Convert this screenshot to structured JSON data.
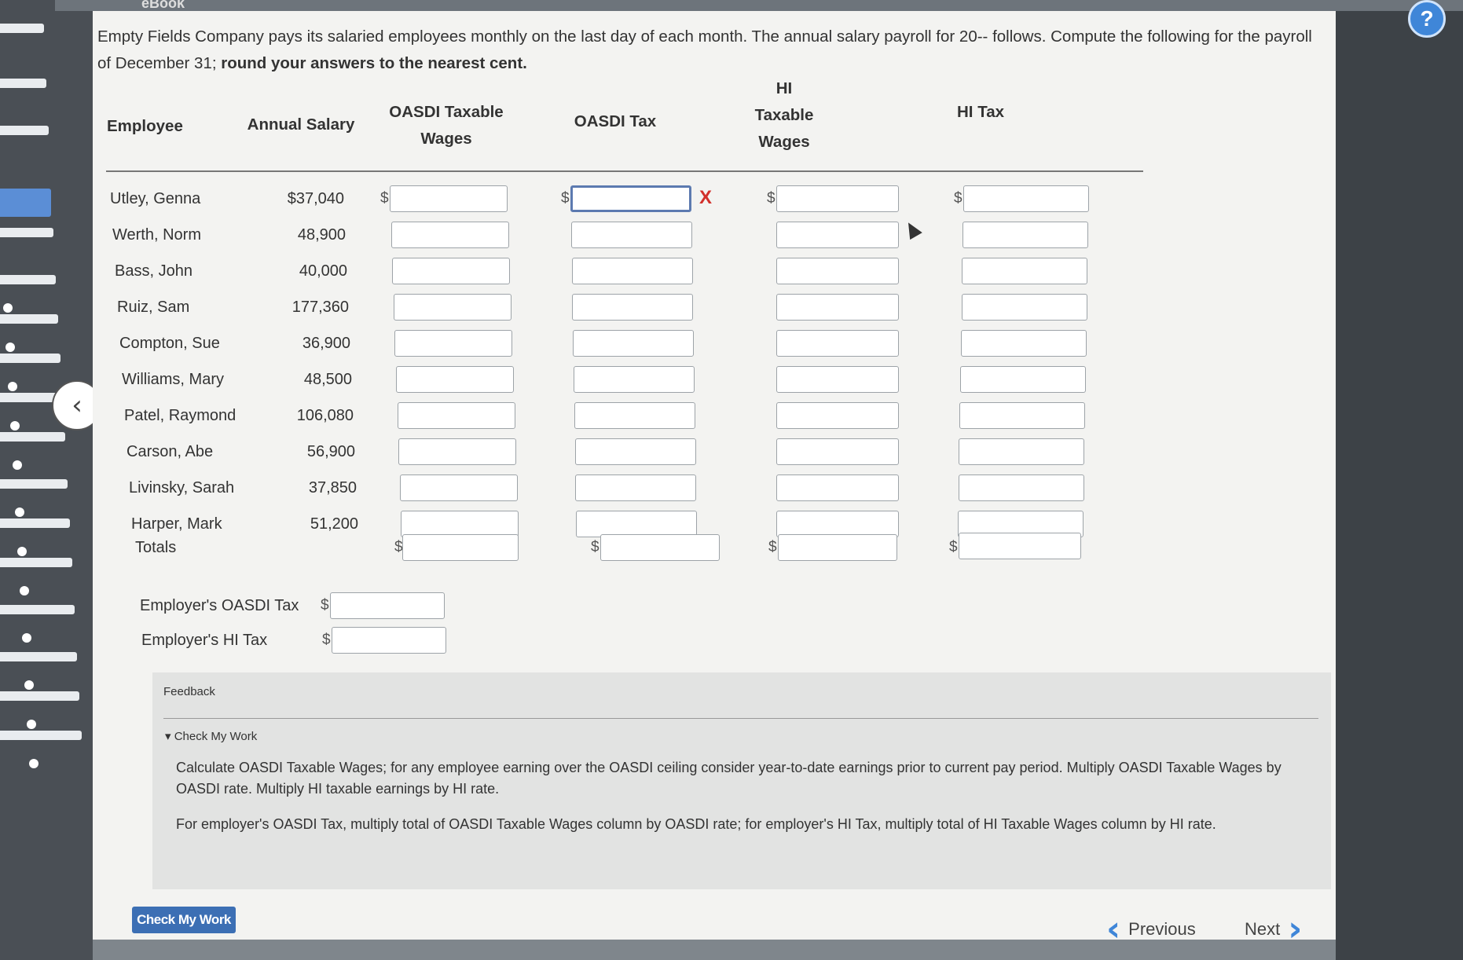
{
  "topbar": {
    "tab_label": "eBook"
  },
  "help": {
    "icon_label": "?"
  },
  "question": {
    "text_part1": "Empty Fields Company pays its salaried employees monthly on the last day of each month. The annual salary payroll for 20-- follows. Compute the following for the payroll of December 31; ",
    "text_bold": "round your answers to the nearest cent."
  },
  "table": {
    "headers": {
      "employee": "Employee",
      "annual_salary": "Annual Salary",
      "oasdi_taxable_1": "OASDI Taxable",
      "oasdi_taxable_2": "Wages",
      "oasdi_tax": "OASDI Tax",
      "hi_taxable_1": "HI",
      "hi_taxable_2": "Taxable",
      "hi_taxable_3": "Wages",
      "hi_tax": "HI Tax"
    },
    "currency_symbol": "$",
    "rows": [
      {
        "employee": "Utley, Genna",
        "salary": "$37,040"
      },
      {
        "employee": "Werth, Norm",
        "salary": "48,900"
      },
      {
        "employee": "Bass, John",
        "salary": "40,000"
      },
      {
        "employee": "Ruiz, Sam",
        "salary": "177,360"
      },
      {
        "employee": "Compton, Sue",
        "salary": "36,900"
      },
      {
        "employee": "Williams, Mary",
        "salary": "48,500"
      },
      {
        "employee": "Patel, Raymond",
        "salary": "106,080"
      },
      {
        "employee": "Carson, Abe",
        "salary": "56,900"
      },
      {
        "employee": "Livinsky, Sarah",
        "salary": "37,850"
      },
      {
        "employee": "Harper, Mark",
        "salary": "51,200"
      }
    ],
    "totals_label": "Totals",
    "error_mark": "X"
  },
  "employer": {
    "oasdi_label": "Employer's OASDI Tax",
    "hi_label": "Employer's HI Tax"
  },
  "feedback": {
    "title": "Feedback",
    "check_toggle": "Check My Work",
    "p1": "Calculate OASDI Taxable Wages; for any employee earning over the OASDI ceiling consider year-to-date earnings prior to current pay period. Multiply OASDI Taxable Wages by OASDI rate. Multiply HI taxable earnings by HI rate.",
    "p2": "For employer's OASDI Tax, multiply total of OASDI Taxable Wages column by OASDI rate; for employer's HI Tax, multiply total of HI Taxable Wages column by HI rate."
  },
  "buttons": {
    "check_my_work": "Check My Work",
    "previous": "Previous",
    "next": "Next"
  }
}
